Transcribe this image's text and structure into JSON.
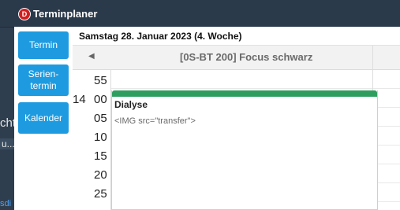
{
  "background": {
    "fragment_1": "cht",
    "fragment_2": "u...",
    "fragment_3": "sdi"
  },
  "window": {
    "title": "Terminplaner",
    "icon_letter": "D"
  },
  "sidebar": {
    "buttons": [
      {
        "label": "Termin"
      },
      {
        "label": "Serien-\ntermin"
      },
      {
        "label": "Kalender"
      }
    ]
  },
  "header": {
    "date": "Samstag 28. Januar 2023 (4. Woche)"
  },
  "resource": {
    "prev_arrow": "◀",
    "title": "[0S-BT 200] Focus schwarz"
  },
  "timeline": {
    "hour": "14",
    "minutes": [
      "55",
      "00",
      "05",
      "10",
      "15",
      "20",
      "25"
    ]
  },
  "appointment": {
    "title": "Dialyse",
    "body": "<IMG src=\"transfer\">",
    "color": "#2e9e5e"
  }
}
